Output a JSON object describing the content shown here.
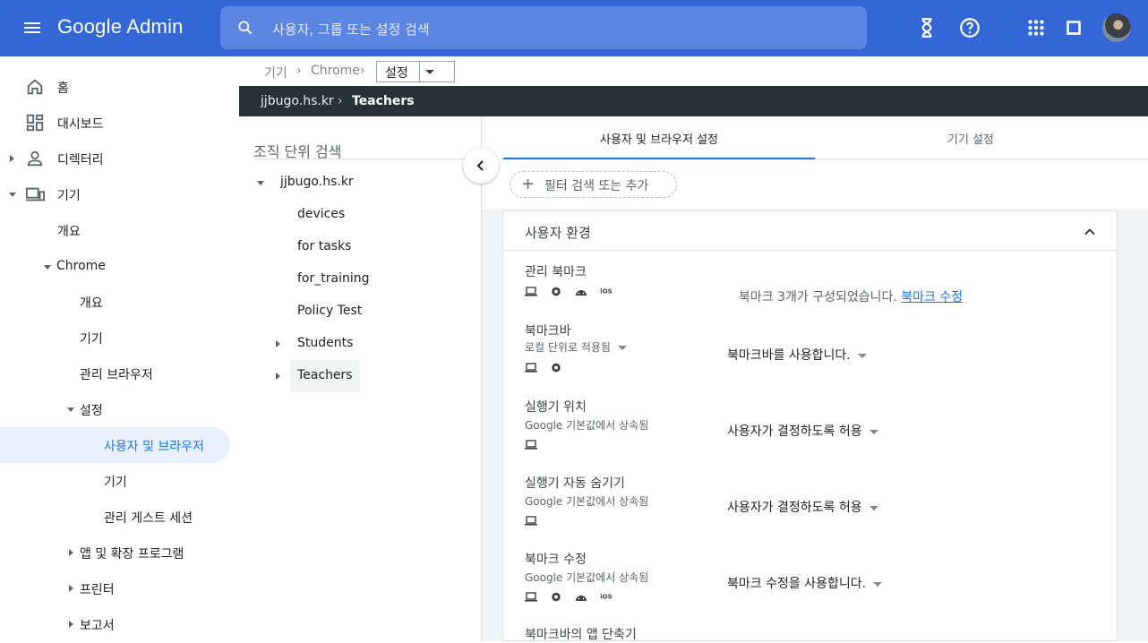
{
  "app": {
    "title": "Google Admin",
    "search_placeholder": "사용자, 그룹 또는 설정 검색"
  },
  "colors": {
    "topbar": "#3367d6",
    "accent": "#1a73e8",
    "org_bar": "#263238"
  },
  "topbar_icons": [
    "hourglass-icon",
    "help-icon",
    "apps-grid-icon",
    "support-window-icon",
    "avatar"
  ],
  "sidebar": {
    "home": "홈",
    "dashboard": "대시보드",
    "directory": "디렉터리",
    "devices": "기기",
    "devices_overview": "개요",
    "chrome": "Chrome",
    "chrome_overview": "개요",
    "chrome_devices": "기기",
    "managed_browsers": "관리 브라우저",
    "settings": "설정",
    "users_browsers": "사용자 및 브라우저",
    "device": "기기",
    "managed_guest": "관리 게스트 세션",
    "apps_extensions": "앱 및 확장 프로그램",
    "printers": "프린터",
    "reports": "보고서"
  },
  "breadcrumb": {
    "item1": "기기",
    "item2": "Chrome",
    "selected": "설정"
  },
  "org_path": {
    "root": "jjbugo.hs.kr",
    "current": "Teachers"
  },
  "ou_panel": {
    "search_placeholder": "조직 단위 검색",
    "root": "jjbugo.hs.kr",
    "children": [
      "devices",
      "for tasks",
      "for_training",
      "Policy Test",
      "Students",
      "Teachers"
    ]
  },
  "tabs": {
    "users_browser": "사용자 및 브라우저 설정",
    "device": "기기 설정"
  },
  "filter": {
    "label": "필터 검색 또는 추가"
  },
  "section": {
    "title": "사용자 환경"
  },
  "settings": [
    {
      "name": "관리 북마크",
      "text": "북마크 3개가 구성되었습니다.",
      "link": "북마크 수정"
    },
    {
      "name": "북마크바",
      "sub": "로컬 단위로 적용됨",
      "value": "북마크바를 사용합니다."
    },
    {
      "name": "실행기 위치",
      "sub": "Google 기본값에서 상속됨",
      "value": "사용자가 결정하도록 허용"
    },
    {
      "name": "실행기 자동 숨기기",
      "sub": "Google 기본값에서 상속됨",
      "value": "사용자가 결정하도록 허용"
    },
    {
      "name": "북마크 수정",
      "sub": "Google 기본값에서 상속됨",
      "value": "북마크 수정을 사용합니다."
    },
    {
      "name": "북마크바의 앱 단축기"
    }
  ],
  "platform_icons": {
    "ios_label": "iOS"
  }
}
